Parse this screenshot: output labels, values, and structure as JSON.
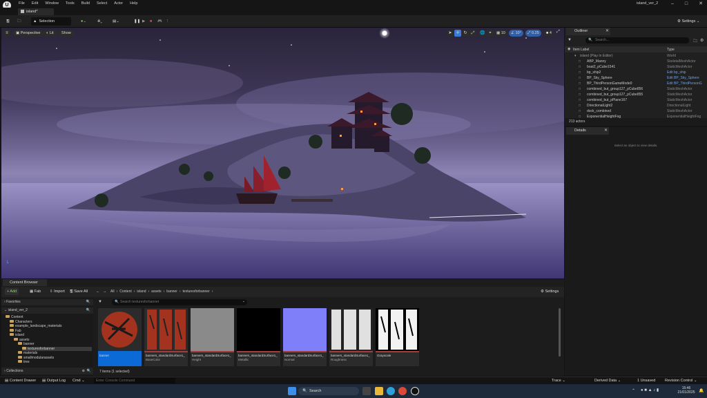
{
  "menubar": {
    "logo": "U",
    "items": [
      "File",
      "Edit",
      "Window",
      "Tools",
      "Build",
      "Select",
      "Actor",
      "Help"
    ],
    "project_name": "island_ver_2",
    "controls": [
      "–",
      "□",
      "✕"
    ]
  },
  "tabs": {
    "document": "island*"
  },
  "toolbar": {
    "selection_mode": "Selection Mode",
    "settings": "Settings"
  },
  "viewport": {
    "perspective": "Perspective",
    "lit": "Lit",
    "show": "Show",
    "grid_value": "10",
    "angle_value": "10°",
    "scale_value": "0.25",
    "camera_speed": "4"
  },
  "outliner": {
    "tab": "Outliner",
    "search_placeholder": "Search...",
    "col_label": "Item Label",
    "col_type": "Type",
    "rows": [
      {
        "label": "island (Play In Editor)",
        "type": "World",
        "link": false,
        "dim": true
      },
      {
        "label": "ABP_Manny",
        "type": "SkeletalMeshActor",
        "link": false
      },
      {
        "label": "boat2_pCube1541",
        "type": "StaticMeshActor",
        "link": false
      },
      {
        "label": "bp_ship2",
        "type": "Edit bp_ship",
        "link": true
      },
      {
        "label": "BP_Sky_Sphere",
        "type": "Edit BP_Sky_Sphere",
        "link": true
      },
      {
        "label": "BP_ThirdPersonGameMode0",
        "type": "Edit BP_ThirdPersonG",
        "link": true
      },
      {
        "label": "combined_but_group127_pCube856",
        "type": "StaticMeshActor",
        "link": false
      },
      {
        "label": "combined_but_group127_pCube855",
        "type": "StaticMeshActor",
        "link": false
      },
      {
        "label": "combined_but_pPlane167",
        "type": "StaticMeshActor",
        "link": false
      },
      {
        "label": "DirectionalLight2",
        "type": "DirectionalLight",
        "link": false
      },
      {
        "label": "dock_combined",
        "type": "StaticMeshActor",
        "link": false
      },
      {
        "label": "ExponentialHeightFog",
        "type": "ExponentialHeightFog",
        "link": false
      }
    ],
    "actor_count": "213 actors"
  },
  "details": {
    "tab": "Details",
    "empty_message": "Select an object to view details."
  },
  "content_browser": {
    "tab": "Content Browser",
    "add": "+ Add",
    "fab": "Fab",
    "import": "Import",
    "save_all": "Save All",
    "settings": "Settings",
    "breadcrumb": [
      "All",
      "Content",
      "island",
      "assets",
      "banner",
      "texturesforbanner"
    ],
    "search_placeholder": "Search texturesforbanner",
    "favorites": "Favorites",
    "project": "island_ver_2",
    "collections": "Collections",
    "status": "7 items (1 selected)",
    "tree": [
      {
        "label": "Content",
        "indent": 0
      },
      {
        "label": "Characters",
        "indent": 1
      },
      {
        "label": "example_landscape_materials",
        "indent": 1
      },
      {
        "label": "Fab",
        "indent": 1
      },
      {
        "label": "island",
        "indent": 1
      },
      {
        "label": "assets",
        "indent": 2
      },
      {
        "label": "banner",
        "indent": 3
      },
      {
        "label": "texturesforbanner",
        "indent": 4
      },
      {
        "label": "materials",
        "indent": 3
      },
      {
        "label": "smallmodularassets",
        "indent": 3
      },
      {
        "label": "tree",
        "indent": 3
      }
    ],
    "assets": [
      {
        "name": "banner",
        "sub": ""
      },
      {
        "name": "banners_standardSurface1_",
        "sub": "BaseColor"
      },
      {
        "name": "banners_standardSurface1_",
        "sub": "Height"
      },
      {
        "name": "banners_standardSurface1_",
        "sub": "Metallic"
      },
      {
        "name": "banners_standardSurface1_",
        "sub": "Normal"
      },
      {
        "name": "banners_standardSurface1_",
        "sub": "Roughness"
      },
      {
        "name": "Grayscale",
        "sub": ""
      }
    ]
  },
  "statusbar": {
    "content_drawer": "Content Drawer",
    "output_log": "Output Log",
    "cmd": "Cmd",
    "console_placeholder": "Enter Console Command",
    "trace": "Trace",
    "derived_data": "Derived Data",
    "unsaved": "1 Unsaved",
    "revision_control": "Revision Control"
  },
  "taskbar": {
    "search": "Search",
    "time": "15:46",
    "date": "21/01/2025"
  }
}
